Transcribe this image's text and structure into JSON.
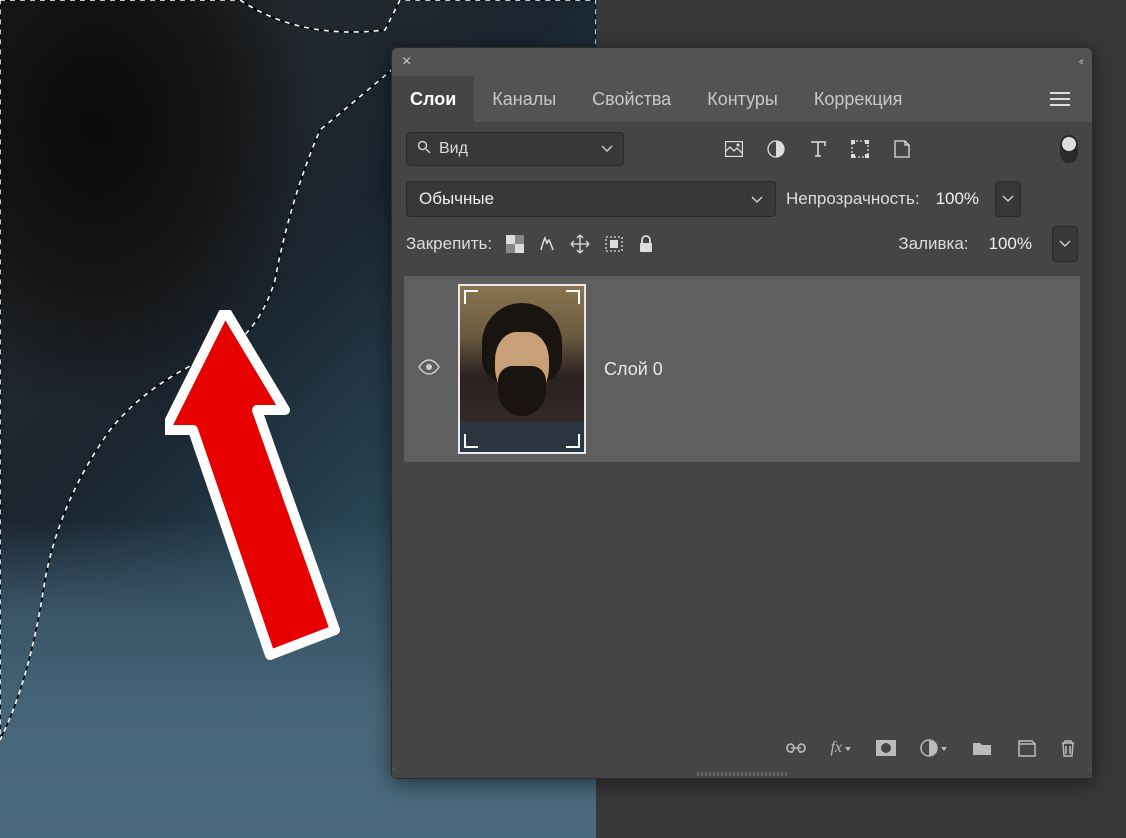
{
  "tabs": {
    "layers": "Слои",
    "channels": "Каналы",
    "properties": "Свойства",
    "paths": "Контуры",
    "adjustments": "Коррекция"
  },
  "search": {
    "placeholder": "Вид"
  },
  "blend": {
    "mode": "Обычные",
    "opacity_label": "Непрозрачность:",
    "opacity_value": "100%"
  },
  "lock": {
    "label": "Закрепить:",
    "fill_label": "Заливка:",
    "fill_value": "100%"
  },
  "layers": [
    {
      "name": "Слой 0"
    }
  ]
}
